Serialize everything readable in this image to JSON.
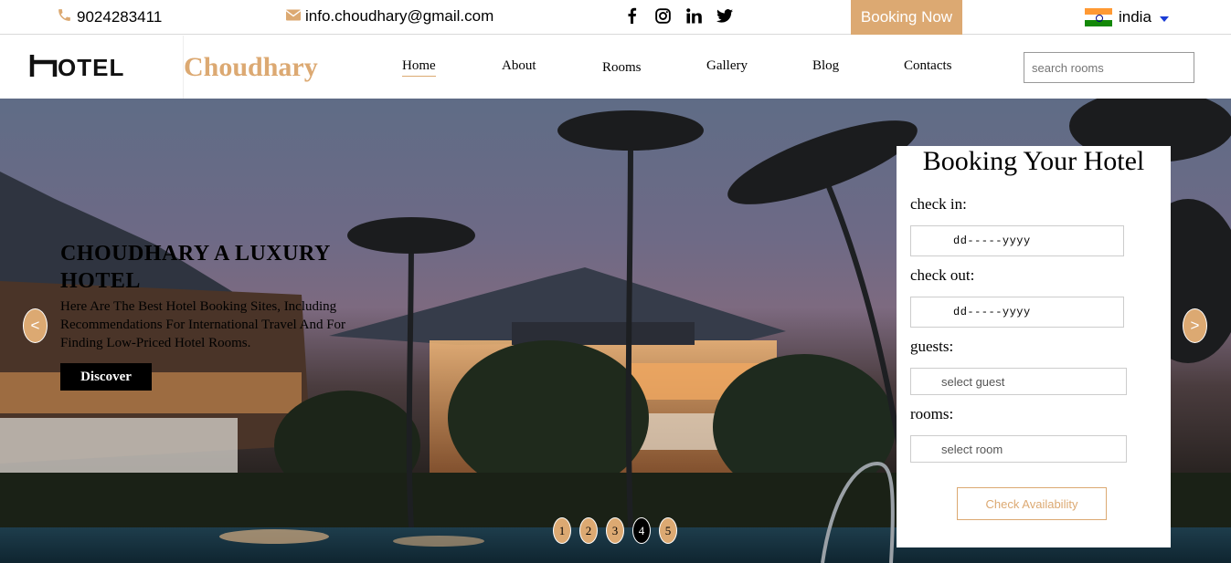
{
  "topbar": {
    "phone": "9024283411",
    "phone_icon": "phone-icon",
    "email": "info.choudhary@gmail.com",
    "email_icon": "envelope-icon",
    "social": [
      "facebook-icon",
      "instagram-icon",
      "linkedin-icon",
      "twitter-icon"
    ],
    "booking_label": "Booking Now",
    "country": "india",
    "accent_color": "#dca972"
  },
  "navbar": {
    "logo_text": "HOTEL",
    "brand": "Choudhary",
    "items": [
      {
        "label": "Home",
        "active": true
      },
      {
        "label": "About"
      },
      {
        "label": "Rooms"
      },
      {
        "label": "Gallery"
      },
      {
        "label": "Blog"
      },
      {
        "label": "Contacts"
      }
    ],
    "search_placeholder": "search rooms"
  },
  "hero": {
    "title": "CHOUDHARY A LUXURY HOTEL",
    "subtitle": "Here Are The Best Hotel Booking Sites, Including Recommendations For International Travel And For Finding Low-Priced Hotel Rooms.",
    "discover_label": "Discover",
    "prev_label": "<",
    "next_label": ">",
    "slides": [
      "1",
      "2",
      "3",
      "4",
      "5"
    ],
    "active_slide": "4"
  },
  "booking": {
    "title": "Booking Your Hotel",
    "checkin_label": "check in:",
    "checkin_value": "dd-----yyyy",
    "checkout_label": "check out:",
    "checkout_value": "dd-----yyyy",
    "guests_label": "guests:",
    "guests_value": "select guest",
    "rooms_label": "rooms:",
    "rooms_value": "select room",
    "button_label": "Check Availability"
  }
}
